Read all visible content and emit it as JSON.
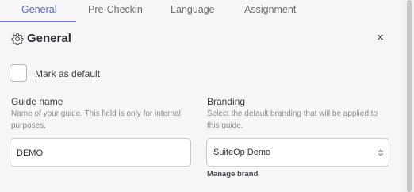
{
  "tabs": [
    {
      "label": "General"
    },
    {
      "label": "Pre-Checkin"
    },
    {
      "label": "Language"
    },
    {
      "label": "Assignment"
    }
  ],
  "header": {
    "title": "General",
    "icon": "gear-icon",
    "close": "×"
  },
  "mark_default": {
    "label": "Mark as default",
    "checked": false
  },
  "guide_name": {
    "label": "Guide name",
    "help_line1": "Name of your guide. This field is only for internal",
    "help_line2": "purposes.",
    "value": "DEMO"
  },
  "branding": {
    "label": "Branding",
    "help_line1": "Select the default branding that will be applied to",
    "help_line2": "this guide.",
    "selected": "SuiteOp Demo",
    "manage_link": "Manage brand"
  },
  "colors": {
    "accent": "#5a63c8"
  }
}
